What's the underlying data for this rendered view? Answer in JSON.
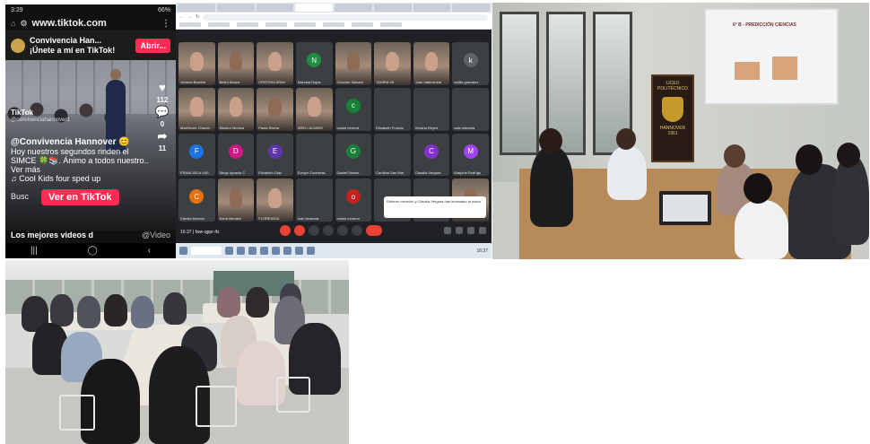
{
  "phone": {
    "status": {
      "time": "3:29",
      "battery": "66%"
    },
    "url": "www.tiktok.com",
    "banner": {
      "title": "Convivencia Han...",
      "subtitle": "¡Únete a mí en TikTok!",
      "open_button": "Abrir..."
    },
    "video": {
      "tiktok_mark": "TikTok",
      "username": "@convivenciahannover1",
      "likes": "112",
      "comments": "0",
      "shares": "11",
      "caption_user": "@Convivencia Hannover 😊",
      "caption_text": "Hoy nuestros segundos rinden el SIMCE 🍀📚. Ánimo a todos nuestro.. Ver más",
      "music": "♫ Cool Kids four sped up",
      "search_hint": "Busc",
      "cta_button": "Ver en TikTok"
    },
    "more_row": {
      "label": "Los mejores videos d",
      "hint": "@Video"
    }
  },
  "meet": {
    "participants": [
      {
        "name": "Ximena Barreta",
        "camera": true
      },
      {
        "name": "Belén Alvara",
        "camera": true
      },
      {
        "name": "CRISTINA ARAV",
        "camera": true
      },
      {
        "name": "Marcela Rojas",
        "initial": "N",
        "color": "#1e8e3e"
      },
      {
        "name": "Gonzalo Salazar",
        "camera": true
      },
      {
        "name": "TAHIRA YA",
        "camera": true
      },
      {
        "name": "Juan Valenzuela",
        "camera": true
      },
      {
        "name": "katiliz gonzalez",
        "camera": false,
        "initial": "k",
        "color": "#5f6368"
      },
      {
        "name": "MacKinzie Chacón",
        "camera": true
      },
      {
        "name": "Monitor Monica",
        "camera": true
      },
      {
        "name": "Paola Rivera",
        "camera": true
      },
      {
        "name": "ARELI ALVARO",
        "camera": true
      },
      {
        "name": "carlos herrera",
        "initial": "c",
        "color": "#188038"
      },
      {
        "name": "Elizabeth Francis",
        "camera": false
      },
      {
        "name": "Viviana Reyes",
        "camera": false
      },
      {
        "name": "sala maestra",
        "camera": false
      },
      {
        "name": "FRANCISCA VAS",
        "initial": "F",
        "color": "#1a73e8"
      },
      {
        "name": "Diego Ignacio C",
        "initial": "D",
        "color": "#d01884"
      },
      {
        "name": "Elizabeth Díaz",
        "initial": "E",
        "color": "#5e35b1"
      },
      {
        "name": "Evelyn Contreras",
        "camera": false
      },
      {
        "name": "Daniel Santos",
        "initial": "G",
        "color": "#188038"
      },
      {
        "name": "Carolina San Mar",
        "camera": false
      },
      {
        "name": "Claudia Vergara",
        "initial": "C",
        "color": "#8430ce"
      },
      {
        "name": "Marjorie Rodrígu",
        "initial": "M",
        "color": "#a142f4"
      },
      {
        "name": "Camila Moreno",
        "initial": "C",
        "color": "#e8710a"
      },
      {
        "name": "Karla Mendez",
        "camera": true
      },
      {
        "name": "FLORENCIA",
        "camera": true
      },
      {
        "name": "Iván Aravena",
        "camera": false
      },
      {
        "name": "carlos moreno",
        "initial": "o",
        "color": "#c5221f"
      },
      {
        "name": "",
        "camera": false
      },
      {
        "name": "",
        "camera": false
      },
      {
        "name": "",
        "camera": true
      }
    ],
    "chat_popup": "Roberto mención y Claudia Vergara han levantado la mano",
    "meeting_code": "fww-qppr-ifx",
    "time": "16:37"
  },
  "room": {
    "slide_title": "6° B - PREDICCIÓN CIENCIAS",
    "banner_lines": [
      "LICEO",
      "POLITÉCNICO",
      "HANNOVER",
      "1961"
    ]
  },
  "colors": {
    "tiktok_red": "#fe2c55",
    "meet_bg": "#202124",
    "meet_end": "#ea4335"
  }
}
